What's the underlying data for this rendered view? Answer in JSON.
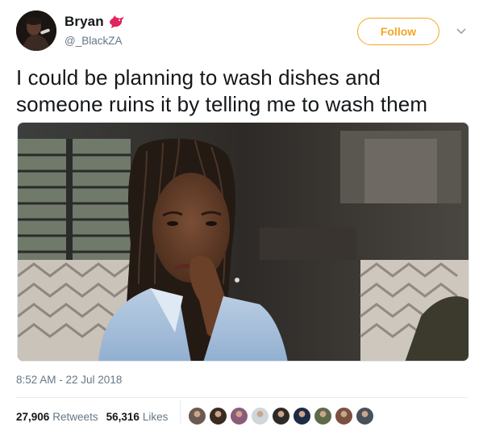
{
  "user": {
    "display_name": "Bryan",
    "handle": "@_BlackZA",
    "avatar_icon": "profile-photo",
    "badge_icon": "red-bird-icon"
  },
  "follow_label": "Follow",
  "tweet_text": "I could be planning to wash dishes and someone ruins it by telling me to wash them",
  "media": {
    "alt_icon": "woman-thinking-photo"
  },
  "timestamp": "8:52 AM - 22 Jul 2018",
  "stats": {
    "retweets_count": "27,906",
    "retweets_label": "Retweets",
    "likes_count": "56,316",
    "likes_label": "Likes"
  },
  "colors": {
    "accent": "#f5a623",
    "text": "#14171a",
    "muted": "#657786",
    "bird": "#e0245e"
  },
  "likers": [
    {
      "color": "#6b5a52"
    },
    {
      "color": "#3b2a22"
    },
    {
      "color": "#8a5c7a"
    },
    {
      "color": "#cfd6dc"
    },
    {
      "color": "#2e2a28"
    },
    {
      "color": "#1d2b44"
    },
    {
      "color": "#5d6a4a"
    },
    {
      "color": "#7a5040"
    },
    {
      "color": "#48505a"
    }
  ]
}
